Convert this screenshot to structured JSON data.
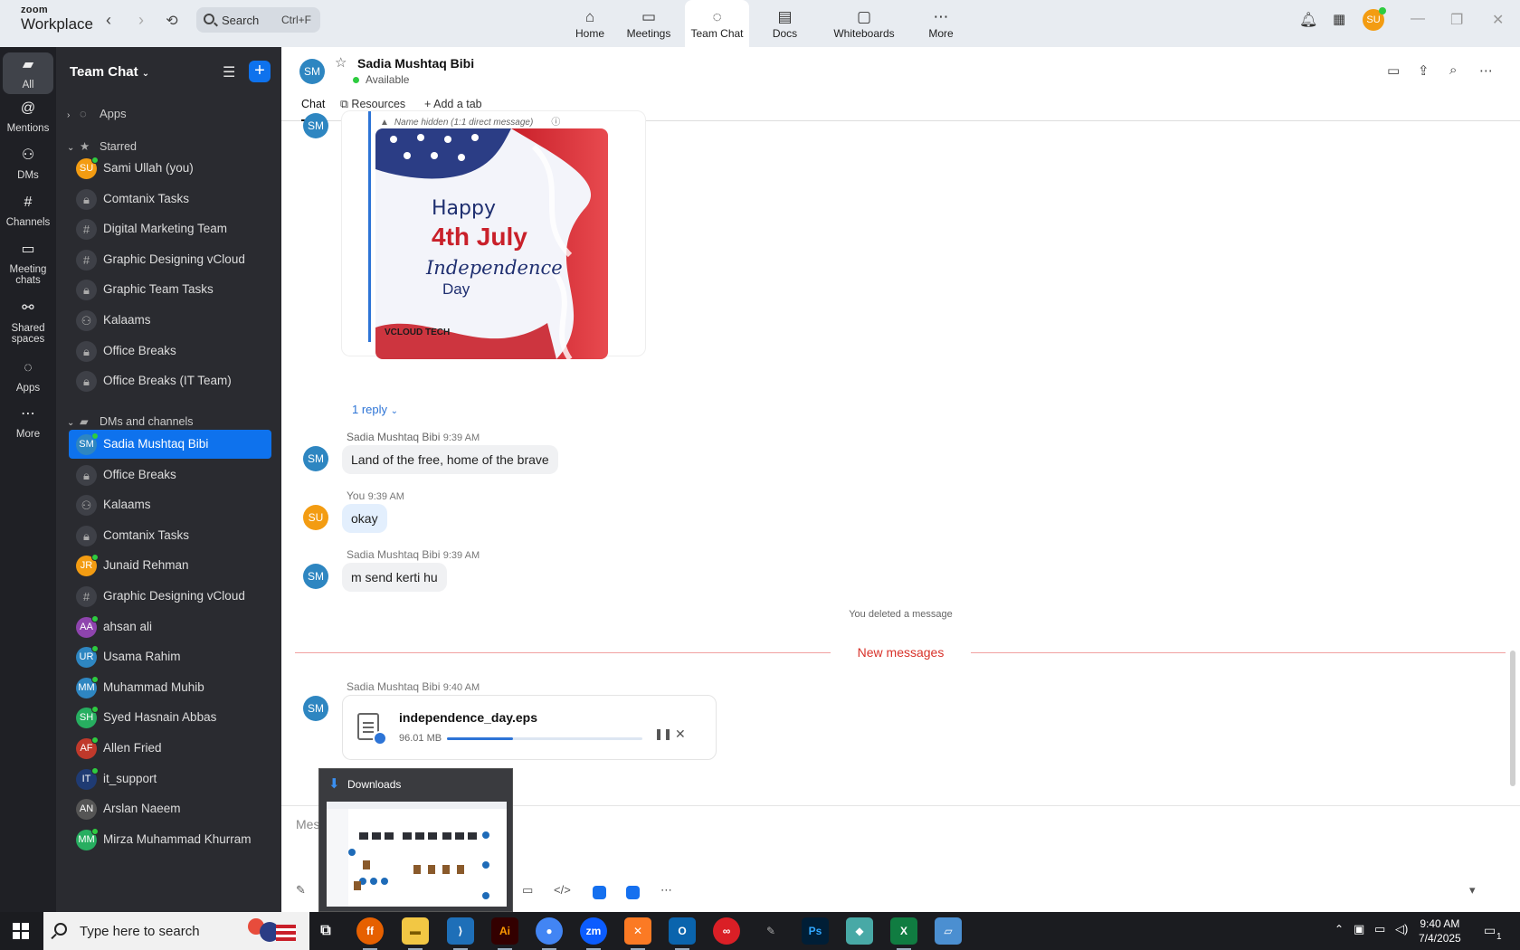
{
  "app": {
    "brand_top": "zoom",
    "brand_bottom": "Workplace",
    "search_placeholder": "Search",
    "search_shortcut": "Ctrl+F",
    "user_initials": "SU"
  },
  "nav_tabs": [
    {
      "label": "Home",
      "icon": "home-icon"
    },
    {
      "label": "Meetings",
      "icon": "video-icon"
    },
    {
      "label": "Team Chat",
      "icon": "chat-icon"
    },
    {
      "label": "Docs",
      "icon": "doc-icon"
    },
    {
      "label": "Whiteboards",
      "icon": "whiteboard-icon"
    },
    {
      "label": "More",
      "icon": "more-icon"
    }
  ],
  "rail": [
    {
      "label": "All",
      "icon": "chat-bubble-icon"
    },
    {
      "label": "Mentions",
      "icon": "at-icon"
    },
    {
      "label": "DMs",
      "icon": "people-icon"
    },
    {
      "label": "Channels",
      "icon": "hash-icon"
    },
    {
      "label": "Meeting chats",
      "icon": "calendar-icon"
    },
    {
      "label": "Shared spaces",
      "icon": "share-icon"
    },
    {
      "label": "Apps",
      "icon": "apps-icon"
    },
    {
      "label": "More",
      "icon": "more-icon"
    }
  ],
  "sidebar": {
    "title": "Team Chat",
    "apps_label": "Apps",
    "starred_label": "Starred",
    "dms_label": "DMs and channels",
    "starred": [
      {
        "label": "Sami Ullah (you)",
        "type": "avatar",
        "initials": "SU",
        "color": "#f39c12",
        "online": true
      },
      {
        "label": "Comtanix Tasks",
        "type": "lock"
      },
      {
        "label": "Digital Marketing Team",
        "type": "hash"
      },
      {
        "label": "Graphic Designing vCloud",
        "type": "hash"
      },
      {
        "label": "Graphic Team Tasks",
        "type": "lock"
      },
      {
        "label": "Kalaams",
        "type": "group"
      },
      {
        "label": "Office Breaks",
        "type": "lock"
      },
      {
        "label": "Office Breaks (IT Team)",
        "type": "lock"
      }
    ],
    "dms": [
      {
        "label": "Sadia Mushtaq Bibi",
        "type": "avatar",
        "initials": "SM",
        "color": "#2e86c1",
        "online": true,
        "selected": true
      },
      {
        "label": "Office Breaks",
        "type": "lock"
      },
      {
        "label": "Kalaams",
        "type": "group"
      },
      {
        "label": "Comtanix Tasks",
        "type": "lock"
      },
      {
        "label": "Junaid Rehman",
        "type": "avatar",
        "initials": "JR",
        "color": "#f39c12",
        "online": true
      },
      {
        "label": "Graphic Designing vCloud",
        "type": "hash"
      },
      {
        "label": "ahsan ali",
        "type": "avatar",
        "initials": "AA",
        "color": "#8e44ad",
        "online": true
      },
      {
        "label": "Usama Rahim",
        "type": "avatar",
        "initials": "UR",
        "color": "#2e86c1",
        "online": true
      },
      {
        "label": "Muhammad Muhib",
        "type": "avatar",
        "initials": "MM",
        "color": "#2e86c1",
        "online": true
      },
      {
        "label": "Syed Hasnain Abbas",
        "type": "avatar",
        "initials": "SH",
        "color": "#27ae60",
        "online": true
      },
      {
        "label": "Allen Fried",
        "type": "avatar",
        "initials": "AF",
        "color": "#c0392b",
        "online": true
      },
      {
        "label": "it_support",
        "type": "avatar",
        "initials": "IT",
        "color": "#1f3b73",
        "online": true
      },
      {
        "label": "Arslan Naeem",
        "type": "avatar",
        "initials": "AN",
        "color": "#555555",
        "online": false
      },
      {
        "label": "Mirza Muhammad Khurram",
        "type": "avatar",
        "initials": "MM",
        "color": "#27ae60",
        "online": true
      }
    ]
  },
  "chat": {
    "contact_name": "Sadia Mushtaq Bibi",
    "contact_initials": "SM",
    "status": "Available",
    "tabs": [
      "Chat",
      "Resources",
      "Add a tab"
    ],
    "quoted_header": "Name hidden (1:1 direct message)",
    "poster": {
      "line1": "Happy",
      "line2": "4th July",
      "line3": "Independence",
      "line4": "Day",
      "brand": "VCLOUD TECH"
    },
    "reply_count": "1 reply",
    "messages": [
      {
        "sender": "Sadia Mushtaq Bibi",
        "time": "9:39 AM",
        "text": "Land of the free, home of the brave",
        "initials": "SM"
      },
      {
        "sender": "You",
        "time": "9:39 AM",
        "text": "okay",
        "initials": "SU"
      },
      {
        "sender": "Sadia Mushtaq Bibi",
        "time": "9:39 AM",
        "text": "m send kerti hu",
        "initials": "SM"
      }
    ],
    "deleted_note": "You deleted a message",
    "new_messages_label": "New messages",
    "file_message": {
      "sender": "Sadia Mushtaq Bibi",
      "time": "9:40 AM",
      "initials": "SM",
      "file_name": "independence_day.eps",
      "file_size": "96.01 MB",
      "progress": 0.34
    },
    "compose_placeholder": "Mes"
  },
  "downloads_popup": {
    "title": "Downloads"
  },
  "taskbar": {
    "search_placeholder": "Type here to search",
    "time": "9:40 AM",
    "date": "7/4/2025",
    "notification_count": "1"
  },
  "colors": {
    "accent": "#0e72ed",
    "sidebar_bg": "#2a2b30",
    "rail_bg": "#1f2025",
    "new_messages": "#d8322a"
  }
}
